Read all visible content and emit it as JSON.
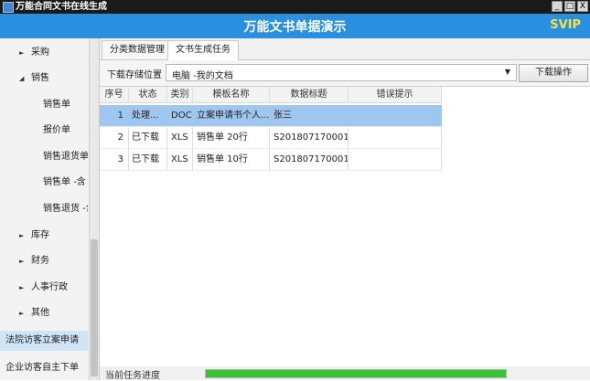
{
  "window": {
    "title": "万能合同文书在线生成",
    "minimize": "_",
    "maximize": "□",
    "close": "X"
  },
  "header": {
    "title": "万能文书单据演示",
    "badge": "SVIP"
  },
  "sidebar": {
    "items": [
      {
        "label": "采购",
        "arrow": "►",
        "kind": "group"
      },
      {
        "label": "销售",
        "arrow": "◢",
        "kind": "group"
      },
      {
        "label": "销售单",
        "kind": "sub"
      },
      {
        "label": "报价单",
        "kind": "sub"
      },
      {
        "label": "销售退货单",
        "kind": "sub"
      },
      {
        "label": "销售单 -含",
        "kind": "sub"
      },
      {
        "label": "销售退货 -含",
        "kind": "sub"
      },
      {
        "label": "库存",
        "arrow": "►",
        "kind": "group"
      },
      {
        "label": "财务",
        "arrow": "►",
        "kind": "group"
      },
      {
        "label": "人事行政",
        "arrow": "►",
        "kind": "group"
      },
      {
        "label": "其他",
        "arrow": "►",
        "kind": "group"
      },
      {
        "label": "法院访客立案申请",
        "kind": "root"
      },
      {
        "label": "企业访客自主下单",
        "kind": "root"
      }
    ]
  },
  "tabs": [
    {
      "label": "分类数据管理",
      "active": false
    },
    {
      "label": "文书生成任务",
      "active": true
    }
  ],
  "toolbar": {
    "location_label": "下载存储位置",
    "location_value": "电脑 -我的文档",
    "download_button": "下载操作"
  },
  "table": {
    "columns": [
      "序号",
      "状态",
      "类别",
      "模板名称",
      "数据标题",
      "错误提示"
    ],
    "rows": [
      [
        "1",
        "处理...",
        "DOC",
        "立案申请书个人...",
        "张三",
        ""
      ],
      [
        "2",
        "已下载",
        "XLS",
        "销售单 20行",
        "S201807170001...",
        ""
      ],
      [
        "3",
        "已下载",
        "XLS",
        "销售单 10行",
        "S201807170001...",
        ""
      ]
    ],
    "selected_row": 0
  },
  "status": {
    "label": "当前任务进度",
    "progress": 1.0
  },
  "colors": {
    "header_bg": "#2b8fe0",
    "badge": "#f5e24a",
    "selection": "#9fc6ee",
    "progress_fill": "#36c436"
  }
}
